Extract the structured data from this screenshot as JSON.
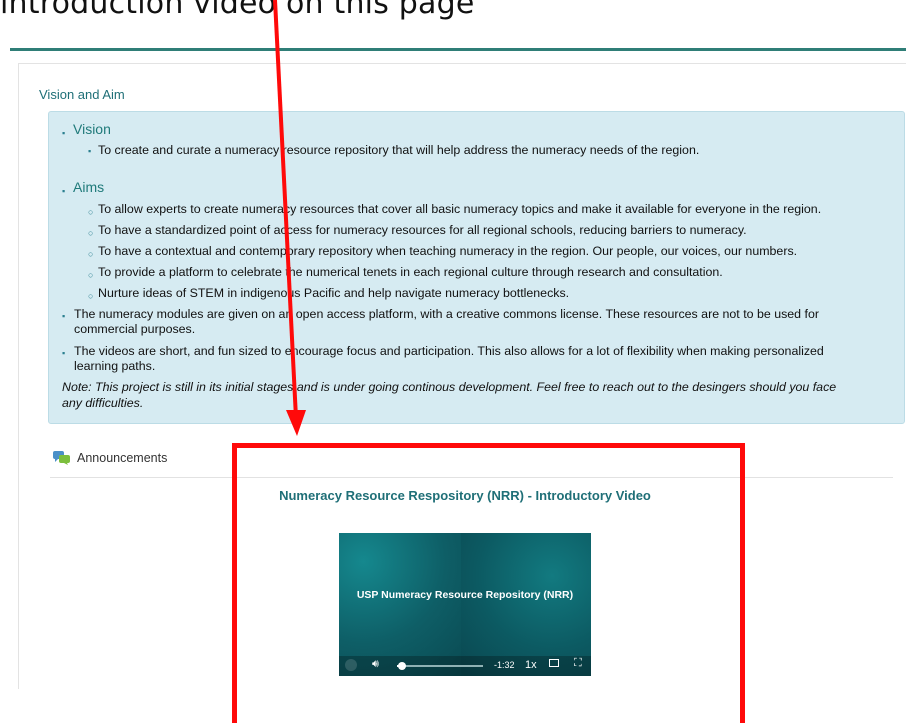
{
  "top_caption": "introduction video on this page",
  "section": {
    "title": "Vision and Aim"
  },
  "vision": {
    "heading": "Vision",
    "item": "To create and curate a numeracy resource repository that will help address the numeracy needs of the region."
  },
  "aims": {
    "heading": "Aims",
    "items": [
      "To allow experts to create numeracy resources that cover all basic numeracy topics and make it available for everyone in the region.",
      "To have a standardized point of access for numeracy resources for all regional schools, reducing barriers to numeracy.",
      "To have a contextual and contemporary repository when teaching numeracy in the region. Our people, our voices, our numbers.",
      "To provide a platform to celebrate the numerical tenets in each regional culture through research and consultation.",
      "Nurture ideas of STEM in indigenous Pacific and help navigate numeracy bottlenecks."
    ]
  },
  "notes": {
    "modules_line1": "The numeracy modules are given on an open access platform, with a creative commons license. These resources are not to be used for",
    "modules_line2": "commercial purposes.",
    "videos_line1": "The videos are short, and fun sized to encourage focus and participation. This also allows for a lot of flexibility when making personalized",
    "videos_line2": "learning paths.",
    "note_line1": "Note: This project is still in its initial stages and is under going continous development. Feel free to reach out to the desingers should you face",
    "note_line2": "any difficulties."
  },
  "announcements": {
    "label": "Announcements",
    "icon": "chat-bubbles-icon"
  },
  "video": {
    "title": "Numeracy Resource Respository (NRR) - Introductory Video",
    "overlay_text": "USP Numeracy Resource Repository (NRR)",
    "time_remaining": "-1:32",
    "speed": "1x",
    "progress_fraction": 0.06
  },
  "colors": {
    "accent_teal": "#1f6f77",
    "info_box_bg": "#d6ebf2",
    "annotation_red": "#ff0a0a"
  }
}
